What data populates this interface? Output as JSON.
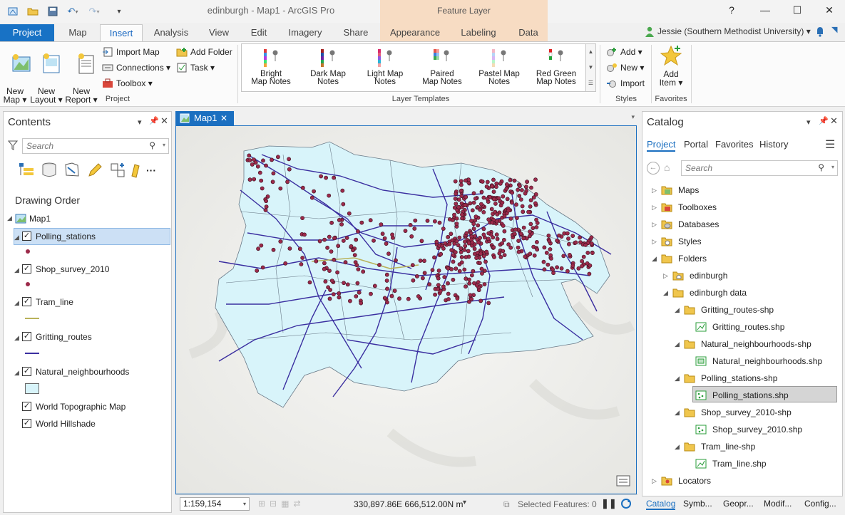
{
  "window": {
    "title": "edinburgh - Map1 - ArcGIS Pro",
    "context_group": "Feature Layer",
    "help": "?",
    "minimize": "—",
    "maximize": "☐",
    "close": "✕"
  },
  "tabs": [
    "Project",
    "Map",
    "Insert",
    "Analysis",
    "View",
    "Edit",
    "Imagery",
    "Share",
    "Appearance",
    "Labeling",
    "Data"
  ],
  "user": "Jessie (Southern Methodist University) ▾",
  "ribbon": {
    "project_group": {
      "label": "Project",
      "new_map": "New\nMap ▾",
      "new_layout": "New\nLayout ▾",
      "new_report": "New\nReport ▾",
      "import_map": "Import Map",
      "connections": "Connections ▾",
      "toolbox": "Toolbox ▾",
      "add_folder": "Add Folder",
      "task": "Task ▾"
    },
    "layer_templates": {
      "label": "Layer Templates",
      "items": [
        {
          "line1": "Bright",
          "line2": "Map Notes"
        },
        {
          "line1": "Dark Map",
          "line2": "Notes"
        },
        {
          "line1": "Light Map",
          "line2": "Notes"
        },
        {
          "line1": "Paired",
          "line2": "Map Notes"
        },
        {
          "line1": "Pastel Map",
          "line2": "Notes"
        },
        {
          "line1": "Red Green",
          "line2": "Map Notes"
        }
      ]
    },
    "styles": {
      "label": "Styles",
      "add": "Add ▾",
      "new": "New ▾",
      "import": "Import"
    },
    "favorites": {
      "label": "Favorites",
      "add_item_line1": "Add",
      "add_item_line2": "Item ▾"
    }
  },
  "contents": {
    "title": "Contents",
    "search_placeholder": "Search",
    "drawing_order": "Drawing Order",
    "map_name": "Map1",
    "layers": [
      "Polling_stations",
      "Shop_survey_2010",
      "Tram_line",
      "Gritting_routes",
      "Natural_neighbourhoods",
      "World Topographic Map",
      "World Hillshade"
    ]
  },
  "map": {
    "tab": "Map1",
    "scale": "1:159,154",
    "coords": "330,897.86E 666,512.00N m",
    "selected": "Selected Features: 0"
  },
  "catalog": {
    "title": "Catalog",
    "tabs": [
      "Project",
      "Portal",
      "Favorites",
      "History"
    ],
    "search_placeholder": "Search",
    "tree": [
      "Maps",
      "Toolboxes",
      "Databases",
      "Styles",
      "Folders",
      "edinburgh",
      "edinburgh data",
      "Gritting_routes-shp",
      "Gritting_routes.shp",
      "Natural_neighbourhoods-shp",
      "Natural_neighbourhoods.shp",
      "Polling_stations-shp",
      "Polling_stations.shp",
      "Shop_survey_2010-shp",
      "Shop_survey_2010.shp",
      "Tram_line-shp",
      "Tram_line.shp",
      "Locators"
    ],
    "bottom_tabs": [
      "Catalog",
      "Symb...",
      "Geopr...",
      "Modif...",
      "Config..."
    ]
  },
  "colors": {
    "accent": "#1b6fc0",
    "project_tab": "#1872c5",
    "context_header": "#f7dcc3",
    "polygon_fill": "#d8f4fa",
    "route_line": "#3b2fa0",
    "point_fill": "#9c2a4a"
  }
}
